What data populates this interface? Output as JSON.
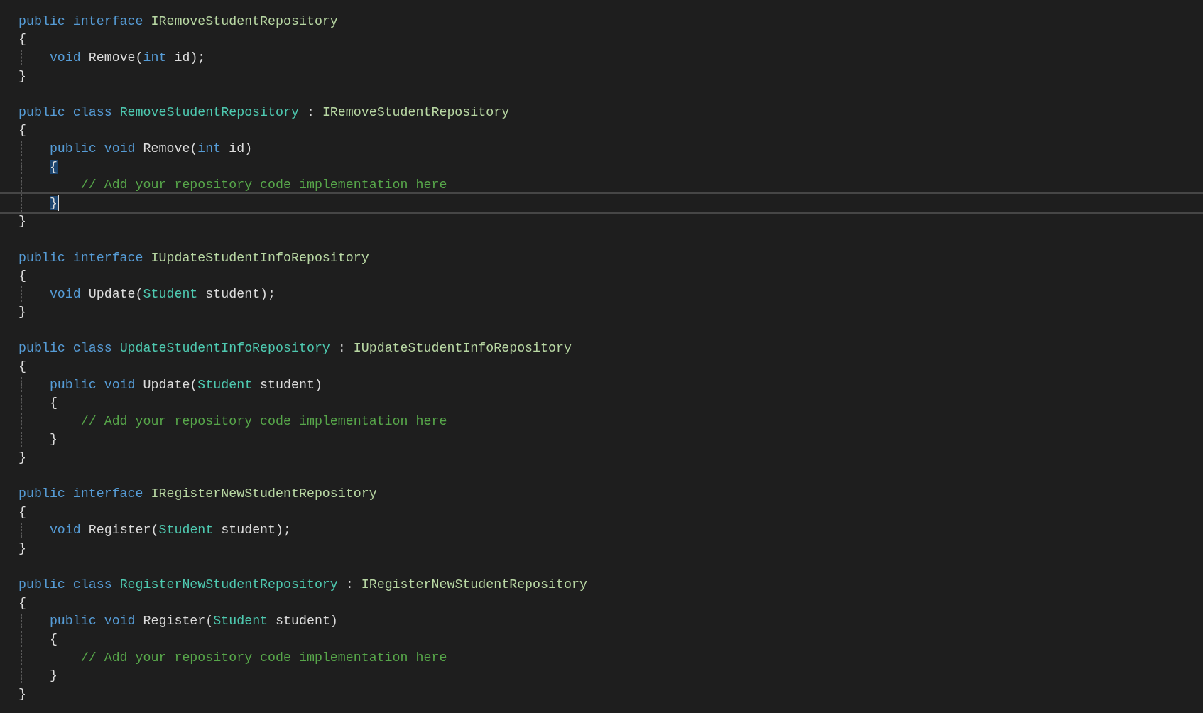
{
  "editor": {
    "lines": [
      {
        "tokens": [
          {
            "text": "public interface ",
            "kind": "keyword"
          },
          {
            "text": "IRemoveStudentRepository",
            "kind": "interface"
          }
        ],
        "current": false
      },
      {
        "tokens": [
          {
            "text": "{",
            "kind": "plain"
          }
        ],
        "current": false,
        "brace_highlighted": false
      },
      {
        "tokens": [
          {
            "text": "    void ",
            "kind": "keyword"
          },
          {
            "text": "Remove(",
            "kind": "plain"
          },
          {
            "text": "int",
            "kind": "keyword"
          },
          {
            "text": " id);",
            "kind": "plain"
          }
        ],
        "current": false
      },
      {
        "tokens": [
          {
            "text": "}",
            "kind": "plain"
          }
        ],
        "current": false,
        "brace_highlighted": false
      },
      {
        "current": false
      },
      {
        "tokens": [
          {
            "text": "public class ",
            "kind": "keyword"
          },
          {
            "text": "RemoveStudentRepository",
            "kind": "class"
          },
          {
            "text": " : ",
            "kind": "plain"
          },
          {
            "text": "IRemoveStudentRepository",
            "kind": "interface"
          }
        ],
        "current": false
      },
      {
        "tokens": [
          {
            "text": "{",
            "kind": "plain"
          }
        ],
        "current": false,
        "brace_highlighted": false
      },
      {
        "tokens": [
          {
            "text": "    public void ",
            "kind": "keyword"
          },
          {
            "text": "Remove(",
            "kind": "plain"
          },
          {
            "text": "int",
            "kind": "keyword"
          },
          {
            "text": " id)",
            "kind": "plain"
          }
        ],
        "current": false
      },
      {
        "tokens": [
          {
            "text": "    {",
            "kind": "plain"
          }
        ],
        "current": false,
        "brace_highlighted": true
      },
      {
        "tokens": [
          {
            "text": "        // Add your repository code implementation here",
            "kind": "comment"
          }
        ],
        "current": false
      },
      {
        "tokens": [
          {
            "text": "    }",
            "kind": "plain"
          }
        ],
        "current": true,
        "brace_highlighted": true
      },
      {
        "tokens": [
          {
            "text": "}",
            "kind": "plain"
          }
        ],
        "current": false,
        "brace_highlighted": false
      },
      {
        "current": false
      },
      {
        "tokens": [
          {
            "text": "public interface ",
            "kind": "keyword"
          },
          {
            "text": "IUpdateStudentInfoRepository",
            "kind": "interface"
          }
        ],
        "current": false
      },
      {
        "tokens": [
          {
            "text": "{",
            "kind": "plain"
          }
        ],
        "current": false,
        "brace_highlighted": false
      },
      {
        "tokens": [
          {
            "text": "    void ",
            "kind": "keyword"
          },
          {
            "text": "Update(",
            "kind": "plain"
          },
          {
            "text": "Student",
            "kind": "class"
          },
          {
            "text": " student);",
            "kind": "plain"
          }
        ],
        "current": false
      },
      {
        "tokens": [
          {
            "text": "}",
            "kind": "plain"
          }
        ],
        "current": false,
        "brace_highlighted": false
      },
      {
        "current": false
      },
      {
        "tokens": [
          {
            "text": "public class ",
            "kind": "keyword"
          },
          {
            "text": "UpdateStudentInfoRepository",
            "kind": "class"
          },
          {
            "text": " : ",
            "kind": "plain"
          },
          {
            "text": "IUpdateStudentInfoRepository",
            "kind": "interface"
          }
        ],
        "current": false
      },
      {
        "tokens": [
          {
            "text": "{",
            "kind": "plain"
          }
        ],
        "current": false,
        "brace_highlighted": false
      },
      {
        "tokens": [
          {
            "text": "    public void ",
            "kind": "keyword"
          },
          {
            "text": "Update(",
            "kind": "plain"
          },
          {
            "text": "Student",
            "kind": "class"
          },
          {
            "text": " student)",
            "kind": "plain"
          }
        ],
        "current": false
      },
      {
        "tokens": [
          {
            "text": "    {",
            "kind": "plain"
          }
        ],
        "current": false,
        "brace_highlighted": false
      },
      {
        "tokens": [
          {
            "text": "        // Add your repository code implementation here",
            "kind": "comment"
          }
        ],
        "current": false
      },
      {
        "tokens": [
          {
            "text": "    }",
            "kind": "plain"
          }
        ],
        "current": false,
        "brace_highlighted": false
      },
      {
        "tokens": [
          {
            "text": "}",
            "kind": "plain"
          }
        ],
        "current": false,
        "brace_highlighted": false
      },
      {
        "current": false
      },
      {
        "tokens": [
          {
            "text": "public interface ",
            "kind": "keyword"
          },
          {
            "text": "IRegisterNewStudentRepository",
            "kind": "interface"
          }
        ],
        "current": false
      },
      {
        "tokens": [
          {
            "text": "{",
            "kind": "plain"
          }
        ],
        "current": false,
        "brace_highlighted": false
      },
      {
        "tokens": [
          {
            "text": "    void ",
            "kind": "keyword"
          },
          {
            "text": "Register(",
            "kind": "plain"
          },
          {
            "text": "Student",
            "kind": "class"
          },
          {
            "text": " student);",
            "kind": "plain"
          }
        ],
        "current": false
      },
      {
        "tokens": [
          {
            "text": "}",
            "kind": "plain"
          }
        ],
        "current": false,
        "brace_highlighted": false
      },
      {
        "current": false
      },
      {
        "tokens": [
          {
            "text": "public class ",
            "kind": "keyword"
          },
          {
            "text": "RegisterNewStudentRepository",
            "kind": "class"
          },
          {
            "text": " : ",
            "kind": "plain"
          },
          {
            "text": "IRegisterNewStudentRepository",
            "kind": "interface"
          }
        ],
        "current": false
      },
      {
        "tokens": [
          {
            "text": "{",
            "kind": "plain"
          }
        ],
        "current": false,
        "brace_highlighted": false
      },
      {
        "tokens": [
          {
            "text": "    public void ",
            "kind": "keyword"
          },
          {
            "text": "Register(",
            "kind": "plain"
          },
          {
            "text": "Student",
            "kind": "class"
          },
          {
            "text": " student)",
            "kind": "plain"
          }
        ],
        "current": false
      },
      {
        "tokens": [
          {
            "text": "    {",
            "kind": "plain"
          }
        ],
        "current": false,
        "brace_highlighted": false
      },
      {
        "tokens": [
          {
            "text": "        // Add your repository code implementation here",
            "kind": "comment"
          }
        ],
        "current": false
      },
      {
        "tokens": [
          {
            "text": "    }",
            "kind": "plain"
          }
        ],
        "current": false,
        "brace_highlighted": false
      },
      {
        "tokens": [
          {
            "text": "}",
            "kind": "plain"
          }
        ],
        "current": false,
        "brace_highlighted": false
      }
    ]
  }
}
